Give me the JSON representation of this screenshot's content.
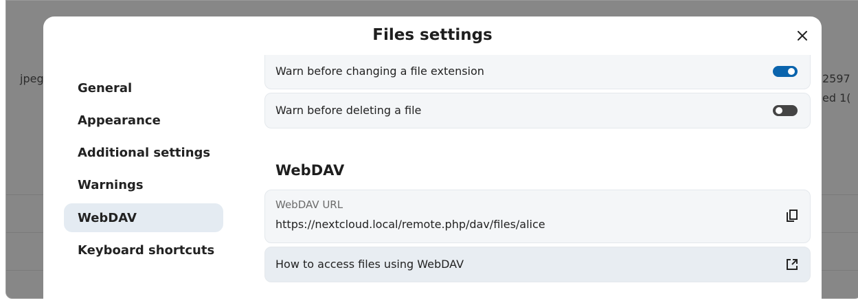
{
  "background": {
    "left_text": "jpeg",
    "right_text_top": "2597",
    "right_text_bottom": "ed 1("
  },
  "modal": {
    "title": "Files settings",
    "close_icon": "close-icon"
  },
  "nav": {
    "items": [
      {
        "label": "General",
        "active": false
      },
      {
        "label": "Appearance",
        "active": false
      },
      {
        "label": "Additional settings",
        "active": false
      },
      {
        "label": "Warnings",
        "active": false
      },
      {
        "label": "WebDAV",
        "active": true
      },
      {
        "label": "Keyboard shortcuts",
        "active": false
      }
    ]
  },
  "warnings": {
    "change_extension": {
      "label": "Warn before changing a file extension",
      "enabled": true
    },
    "delete_file": {
      "label": "Warn before deleting a file",
      "enabled": false
    }
  },
  "webdav": {
    "title": "WebDAV",
    "url_label": "WebDAV URL",
    "url_value": "https://nextcloud.local/remote.php/dav/files/alice",
    "copy_icon": "copy-icon",
    "help_link_label": "How to access files using WebDAV",
    "external_link_icon": "external-link-icon"
  },
  "colors": {
    "accent": "#0a64ad",
    "active_nav_bg": "#e4ebf2",
    "backdrop": "#878787"
  }
}
